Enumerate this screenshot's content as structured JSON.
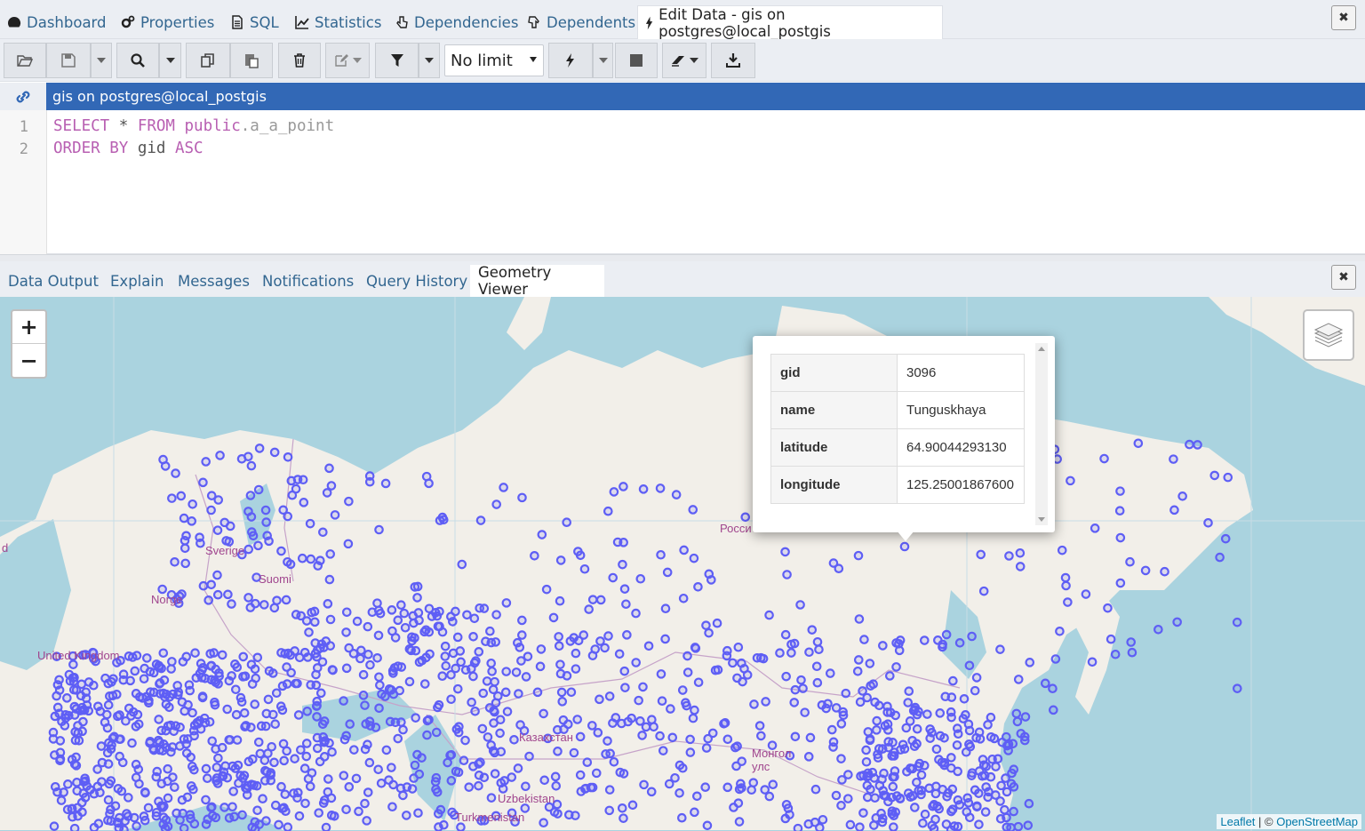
{
  "tabs": [
    {
      "label": "Dashboard",
      "icon": "dashboard-icon"
    },
    {
      "label": "Properties",
      "icon": "gears-icon"
    },
    {
      "label": "SQL",
      "icon": "file-icon"
    },
    {
      "label": "Statistics",
      "icon": "chart-icon"
    },
    {
      "label": "Dependencies",
      "icon": "hand-icon"
    },
    {
      "label": "Dependents",
      "icon": "hand-icon"
    },
    {
      "label": "Edit Data - gis on postgres@local_postgis",
      "icon": "bolt-icon",
      "active": true
    }
  ],
  "toolbar": {
    "limit_value": "No limit"
  },
  "connection": {
    "label": "gis on postgres@local_postgis"
  },
  "editor": {
    "line_numbers": [
      "1",
      "2"
    ],
    "line1": {
      "kw1": "SELECT",
      "star": " * ",
      "kw2": "FROM",
      "schema": " public",
      "table": ".a_a_point"
    },
    "line2": {
      "kw1": "ORDER BY",
      "col": " gid ",
      "kw2": "ASC"
    }
  },
  "result_tabs": [
    {
      "label": "Data Output"
    },
    {
      "label": "Explain"
    },
    {
      "label": "Messages"
    },
    {
      "label": "Notifications"
    },
    {
      "label": "Query History"
    },
    {
      "label": "Geometry Viewer",
      "active": true
    }
  ],
  "map": {
    "zoom_in": "+",
    "zoom_out": "−",
    "labels": [
      "Sverige",
      "Suomi",
      "Norge",
      "United Kingdom",
      "Росси",
      "Казахстан",
      "Монгол улс",
      "Uzbekistan",
      "Turkmenistan",
      "d"
    ],
    "attribution": {
      "leaflet": "Leaflet",
      "sep": " | © ",
      "osm": "OpenStreetMap"
    },
    "popup": {
      "rows": [
        {
          "key": "gid",
          "value": "3096"
        },
        {
          "key": "name",
          "value": "Tunguskhaya"
        },
        {
          "key": "latitude",
          "value": "64.90044293130"
        },
        {
          "key": "longitude",
          "value": "125.25001867600"
        }
      ]
    },
    "colors": {
      "water": "#aad3df",
      "land": "#f2efe9",
      "point": "#5e5ef5"
    }
  }
}
